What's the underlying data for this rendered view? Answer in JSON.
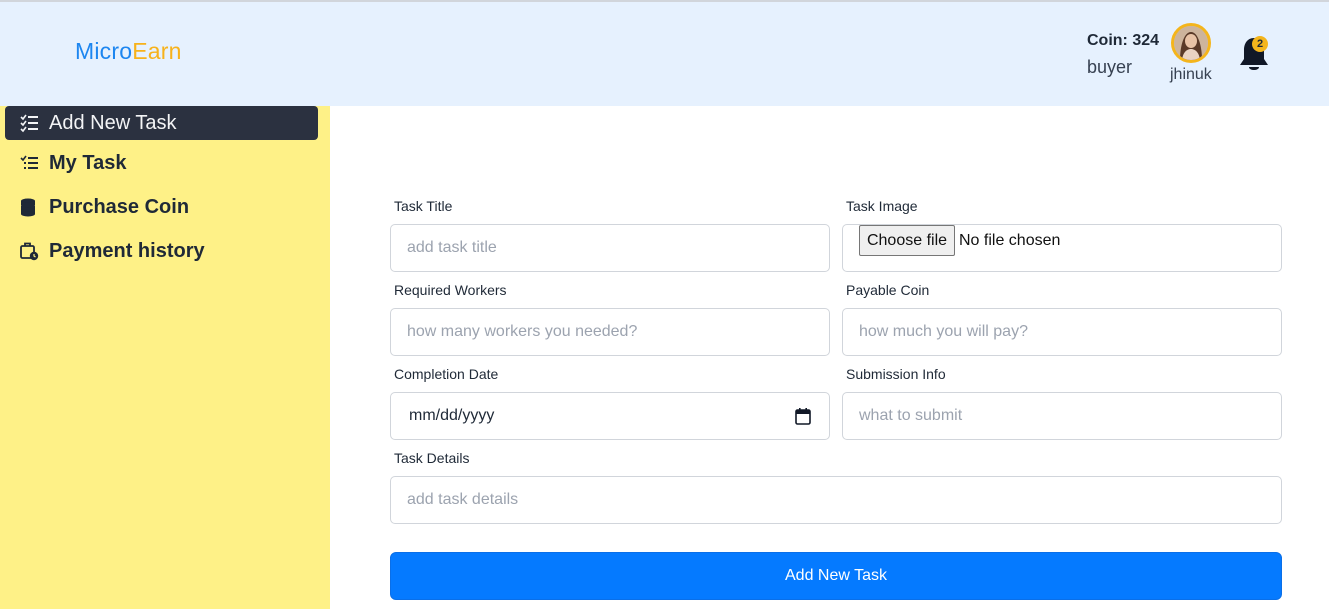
{
  "brand": {
    "part1": "Micro",
    "part2": "Earn",
    "color1": "#1d86f0",
    "color2": "#f7b21b"
  },
  "header": {
    "coin_text": "Coin: 324",
    "role": "buyer",
    "username": "jhinuk",
    "notification_count": "2",
    "avatar_icon": "user-avatar"
  },
  "sidebar": {
    "items": [
      {
        "label": "Add New Task",
        "icon": "checklist-icon",
        "active": true
      },
      {
        "label": "My Task",
        "icon": "task-list-icon",
        "active": false
      },
      {
        "label": "Purchase Coin",
        "icon": "coins-icon",
        "active": false
      },
      {
        "label": "Payment history",
        "icon": "briefcase-clock-icon",
        "active": false
      }
    ]
  },
  "form": {
    "task_title": {
      "label": "Task Title",
      "placeholder": "add task title"
    },
    "task_image": {
      "label": "Task Image",
      "button": "Choose file",
      "status": "No file chosen"
    },
    "required_workers": {
      "label": "Required Workers",
      "placeholder": "how many workers you needed?"
    },
    "payable_coin": {
      "label": "Payable Coin",
      "placeholder": "how much you will pay?"
    },
    "completion_date": {
      "label": "Completion Date",
      "value_display": "mm/dd/yyyy"
    },
    "submission_info": {
      "label": "Submission Info",
      "placeholder": "what to submit"
    },
    "task_details": {
      "label": "Task Details",
      "placeholder": "add task details"
    },
    "submit_label": "Add New Task"
  },
  "colors": {
    "header_bg": "#e6f1fe",
    "sidebar_bg": "#fef187",
    "active_item_bg": "#2b3140",
    "primary_button": "#057aff",
    "accent_badge": "#f4b51c"
  }
}
